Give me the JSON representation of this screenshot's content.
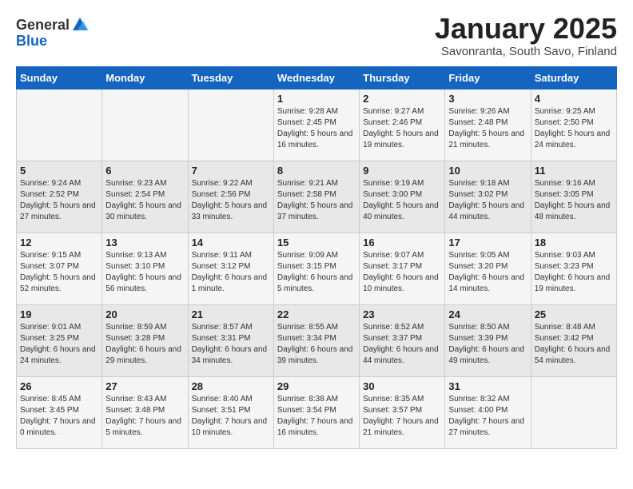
{
  "logo": {
    "general": "General",
    "blue": "Blue"
  },
  "title": "January 2025",
  "subtitle": "Savonranta, South Savo, Finland",
  "weekdays": [
    "Sunday",
    "Monday",
    "Tuesday",
    "Wednesday",
    "Thursday",
    "Friday",
    "Saturday"
  ],
  "weeks": [
    [
      {
        "day": "",
        "info": ""
      },
      {
        "day": "",
        "info": ""
      },
      {
        "day": "",
        "info": ""
      },
      {
        "day": "1",
        "info": "Sunrise: 9:28 AM\nSunset: 2:45 PM\nDaylight: 5 hours and 16 minutes."
      },
      {
        "day": "2",
        "info": "Sunrise: 9:27 AM\nSunset: 2:46 PM\nDaylight: 5 hours and 19 minutes."
      },
      {
        "day": "3",
        "info": "Sunrise: 9:26 AM\nSunset: 2:48 PM\nDaylight: 5 hours and 21 minutes."
      },
      {
        "day": "4",
        "info": "Sunrise: 9:25 AM\nSunset: 2:50 PM\nDaylight: 5 hours and 24 minutes."
      }
    ],
    [
      {
        "day": "5",
        "info": "Sunrise: 9:24 AM\nSunset: 2:52 PM\nDaylight: 5 hours and 27 minutes."
      },
      {
        "day": "6",
        "info": "Sunrise: 9:23 AM\nSunset: 2:54 PM\nDaylight: 5 hours and 30 minutes."
      },
      {
        "day": "7",
        "info": "Sunrise: 9:22 AM\nSunset: 2:56 PM\nDaylight: 5 hours and 33 minutes."
      },
      {
        "day": "8",
        "info": "Sunrise: 9:21 AM\nSunset: 2:58 PM\nDaylight: 5 hours and 37 minutes."
      },
      {
        "day": "9",
        "info": "Sunrise: 9:19 AM\nSunset: 3:00 PM\nDaylight: 5 hours and 40 minutes."
      },
      {
        "day": "10",
        "info": "Sunrise: 9:18 AM\nSunset: 3:02 PM\nDaylight: 5 hours and 44 minutes."
      },
      {
        "day": "11",
        "info": "Sunrise: 9:16 AM\nSunset: 3:05 PM\nDaylight: 5 hours and 48 minutes."
      }
    ],
    [
      {
        "day": "12",
        "info": "Sunrise: 9:15 AM\nSunset: 3:07 PM\nDaylight: 5 hours and 52 minutes."
      },
      {
        "day": "13",
        "info": "Sunrise: 9:13 AM\nSunset: 3:10 PM\nDaylight: 5 hours and 56 minutes."
      },
      {
        "day": "14",
        "info": "Sunrise: 9:11 AM\nSunset: 3:12 PM\nDaylight: 6 hours and 1 minute."
      },
      {
        "day": "15",
        "info": "Sunrise: 9:09 AM\nSunset: 3:15 PM\nDaylight: 6 hours and 5 minutes."
      },
      {
        "day": "16",
        "info": "Sunrise: 9:07 AM\nSunset: 3:17 PM\nDaylight: 6 hours and 10 minutes."
      },
      {
        "day": "17",
        "info": "Sunrise: 9:05 AM\nSunset: 3:20 PM\nDaylight: 6 hours and 14 minutes."
      },
      {
        "day": "18",
        "info": "Sunrise: 9:03 AM\nSunset: 3:23 PM\nDaylight: 6 hours and 19 minutes."
      }
    ],
    [
      {
        "day": "19",
        "info": "Sunrise: 9:01 AM\nSunset: 3:25 PM\nDaylight: 6 hours and 24 minutes."
      },
      {
        "day": "20",
        "info": "Sunrise: 8:59 AM\nSunset: 3:28 PM\nDaylight: 6 hours and 29 minutes."
      },
      {
        "day": "21",
        "info": "Sunrise: 8:57 AM\nSunset: 3:31 PM\nDaylight: 6 hours and 34 minutes."
      },
      {
        "day": "22",
        "info": "Sunrise: 8:55 AM\nSunset: 3:34 PM\nDaylight: 6 hours and 39 minutes."
      },
      {
        "day": "23",
        "info": "Sunrise: 8:52 AM\nSunset: 3:37 PM\nDaylight: 6 hours and 44 minutes."
      },
      {
        "day": "24",
        "info": "Sunrise: 8:50 AM\nSunset: 3:39 PM\nDaylight: 6 hours and 49 minutes."
      },
      {
        "day": "25",
        "info": "Sunrise: 8:48 AM\nSunset: 3:42 PM\nDaylight: 6 hours and 54 minutes."
      }
    ],
    [
      {
        "day": "26",
        "info": "Sunrise: 8:45 AM\nSunset: 3:45 PM\nDaylight: 7 hours and 0 minutes."
      },
      {
        "day": "27",
        "info": "Sunrise: 8:43 AM\nSunset: 3:48 PM\nDaylight: 7 hours and 5 minutes."
      },
      {
        "day": "28",
        "info": "Sunrise: 8:40 AM\nSunset: 3:51 PM\nDaylight: 7 hours and 10 minutes."
      },
      {
        "day": "29",
        "info": "Sunrise: 8:38 AM\nSunset: 3:54 PM\nDaylight: 7 hours and 16 minutes."
      },
      {
        "day": "30",
        "info": "Sunrise: 8:35 AM\nSunset: 3:57 PM\nDaylight: 7 hours and 21 minutes."
      },
      {
        "day": "31",
        "info": "Sunrise: 8:32 AM\nSunset: 4:00 PM\nDaylight: 7 hours and 27 minutes."
      },
      {
        "day": "",
        "info": ""
      }
    ]
  ]
}
